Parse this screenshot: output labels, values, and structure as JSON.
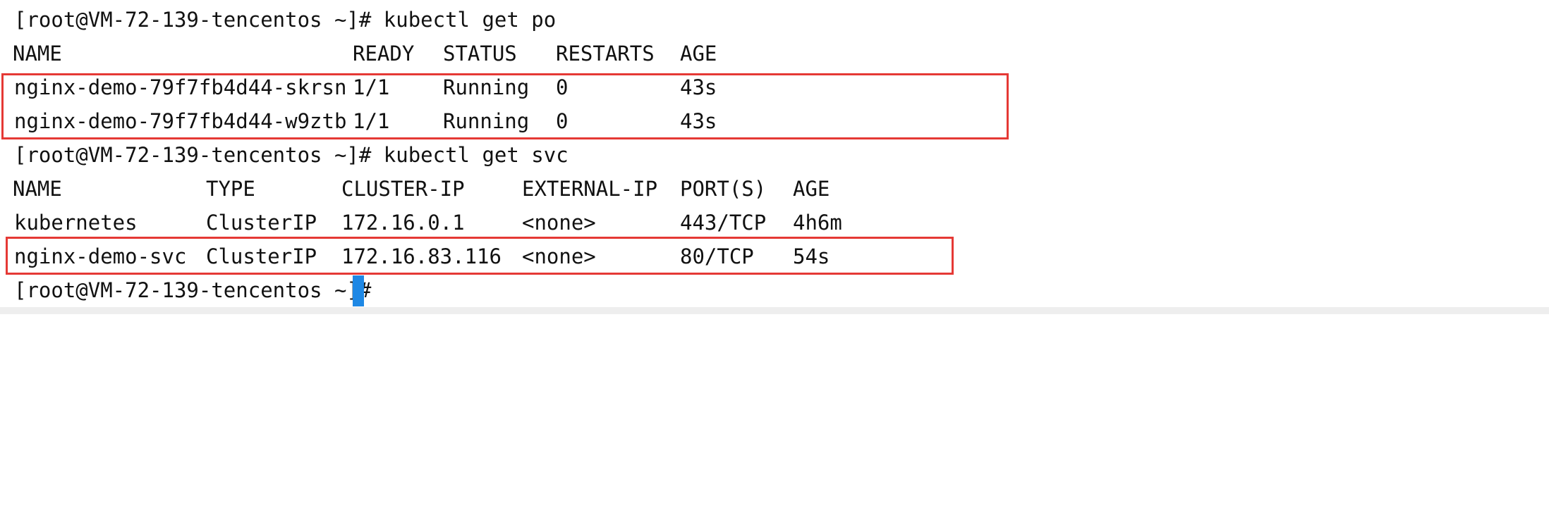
{
  "terminal": {
    "prompt": "[root@VM-72-139-tencentos ~]# ",
    "commands": {
      "get_po": "kubectl get po",
      "get_svc": "kubectl get svc",
      "final": ""
    },
    "pods": {
      "headers": [
        "NAME",
        "READY",
        "STATUS",
        "RESTARTS",
        "AGE"
      ],
      "rows": [
        [
          "nginx-demo-79f7fb4d44-skrsn",
          "1/1",
          "Running",
          "0",
          "43s"
        ],
        [
          "nginx-demo-79f7fb4d44-w9ztb",
          "1/1",
          "Running",
          "0",
          "43s"
        ]
      ]
    },
    "services": {
      "headers": [
        "NAME",
        "TYPE",
        "CLUSTER-IP",
        "EXTERNAL-IP",
        "PORT(S)",
        "AGE"
      ],
      "rows": [
        [
          "kubernetes",
          "ClusterIP",
          "172.16.0.1",
          "<none>",
          "443/TCP",
          "4h6m"
        ],
        [
          "nginx-demo-svc",
          "ClusterIP",
          "172.16.83.116",
          "<none>",
          "80/TCP",
          "54s"
        ]
      ]
    },
    "colors": {
      "text": "#111111",
      "highlight": "#e53935",
      "cursor": "#1e88e5"
    }
  }
}
